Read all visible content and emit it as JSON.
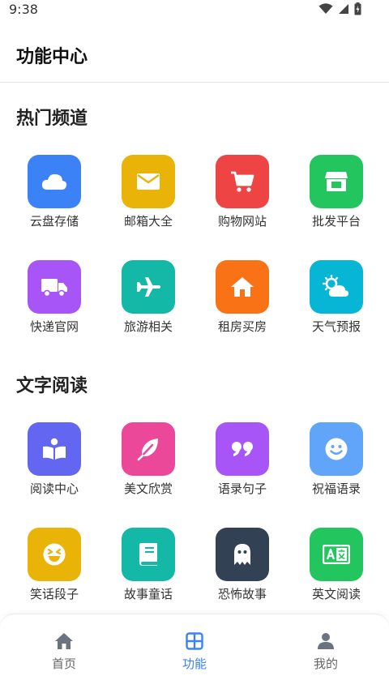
{
  "status_bar": {
    "time": "9:38"
  },
  "header": {
    "title": "功能中心"
  },
  "sections": [
    {
      "title": "热门频道",
      "items": [
        {
          "label": "云盘存储",
          "icon": "cloud-icon",
          "color": "#3b82f6"
        },
        {
          "label": "邮箱大全",
          "icon": "mail-icon",
          "color": "#eab308"
        },
        {
          "label": "购物网站",
          "icon": "cart-icon",
          "color": "#ef4444"
        },
        {
          "label": "批发平台",
          "icon": "store-icon",
          "color": "#22c55e"
        },
        {
          "label": "快递官网",
          "icon": "truck-icon",
          "color": "#a855f7"
        },
        {
          "label": "旅游相关",
          "icon": "plane-icon",
          "color": "#14b8a6"
        },
        {
          "label": "租房买房",
          "icon": "house-icon",
          "color": "#f97316"
        },
        {
          "label": "天气预报",
          "icon": "weather-icon",
          "color": "#06b6d4"
        }
      ]
    },
    {
      "title": "文字阅读",
      "items": [
        {
          "label": "阅读中心",
          "icon": "book-reader-icon",
          "color": "#6366f1"
        },
        {
          "label": "美文欣赏",
          "icon": "feather-icon",
          "color": "#ec4899"
        },
        {
          "label": "语录句子",
          "icon": "quote-icon",
          "color": "#a855f7"
        },
        {
          "label": "祝福语录",
          "icon": "smile-icon",
          "color": "#60a5fa"
        },
        {
          "label": "笑话段子",
          "icon": "laugh-icon",
          "color": "#eab308"
        },
        {
          "label": "故事童话",
          "icon": "book-icon",
          "color": "#14b8a6"
        },
        {
          "label": "恐怖故事",
          "icon": "ghost-icon",
          "color": "#334155"
        },
        {
          "label": "英文阅读",
          "icon": "translate-icon",
          "color": "#22c55e"
        }
      ]
    }
  ],
  "bottom_nav": [
    {
      "label": "首页",
      "icon": "home-icon",
      "active": false
    },
    {
      "label": "功能",
      "icon": "grid-icon",
      "active": true
    },
    {
      "label": "我的",
      "icon": "user-icon",
      "active": false
    }
  ],
  "colors": {
    "active": "#3b82f6",
    "inactive": "#6b7280"
  }
}
